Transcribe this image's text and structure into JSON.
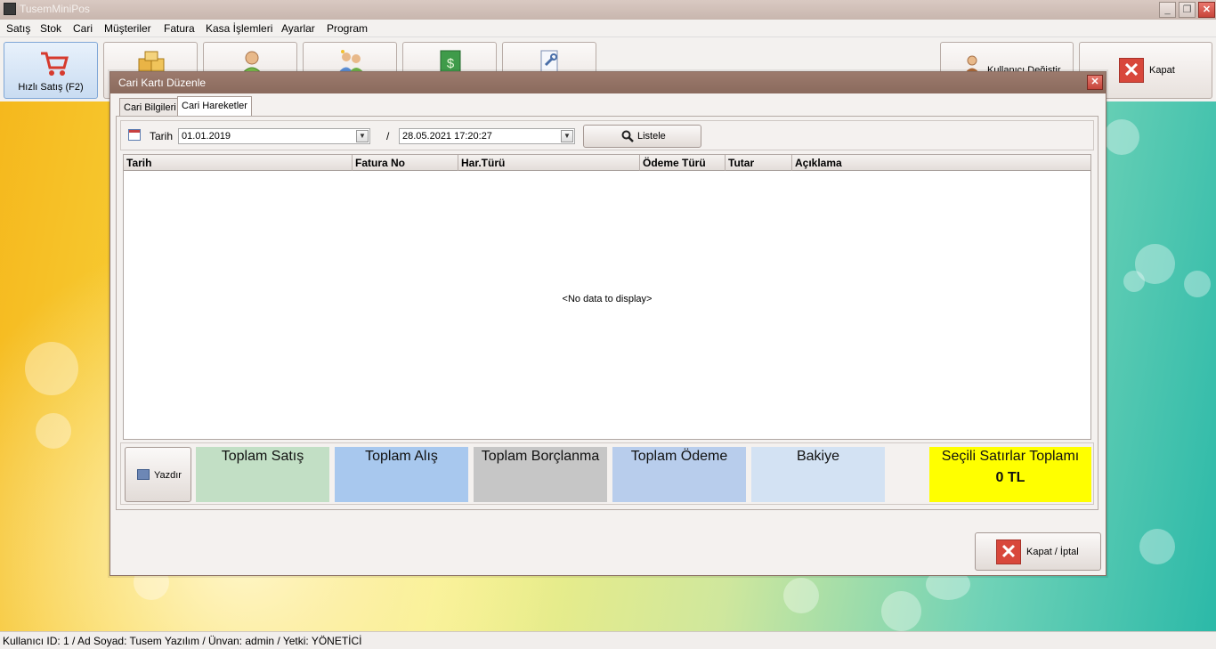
{
  "window": {
    "title": "TusemMiniPos"
  },
  "menu": [
    "Satış",
    "Stok",
    "Cari",
    "Müşteriler",
    "Fatura",
    "Kasa İşlemleri",
    "Ayarlar",
    "Program"
  ],
  "toolbar": {
    "hizli_satis": "Hızlı Satış (F2)",
    "kullanici_degistir": "Kullanıcı Değiştir",
    "kapat": "Kapat"
  },
  "dialog": {
    "title": "Cari Kartı Düzenle",
    "tabs": [
      "Cari Bilgileri",
      "Cari Hareketler"
    ],
    "filter": {
      "label": "Tarih",
      "date_from": "01.01.2019",
      "separator": "/",
      "date_to": "28.05.2021 17:20:27",
      "list_button": "Listele"
    },
    "grid": {
      "columns": [
        "Tarih",
        "Fatura No",
        "Har.Türü",
        "Ödeme Türü",
        "Tutar",
        "Açıklama"
      ],
      "empty_text": "<No data to display>"
    },
    "summary": {
      "print_button": "Yazdır",
      "boxes": [
        "Toplam Satış",
        "Toplam Alış",
        "Toplam Borçlanma",
        "Toplam Ödeme",
        "Bakiye"
      ],
      "selected_total_label": "Seçili Satırlar Toplamı",
      "selected_total_value": "0 TL"
    },
    "close_button": "Kapat / İptal"
  },
  "status": "Kullanıcı ID: 1 / Ad Soyad: Tusem Yazılım / Ünvan: admin / Yetki: YÖNETİCİ",
  "colors": {
    "toplam_satis": "#c2dfc5",
    "toplam_alis": "#a8c8ee",
    "toplam_borclanma": "#c6c6c6",
    "toplam_odeme": "#b8cdec",
    "bakiye": "#d3e2f3",
    "secili": "#ffff00",
    "dialog_title": "#8f6f62"
  }
}
